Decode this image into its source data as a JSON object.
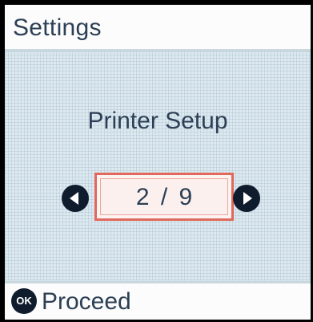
{
  "header": {
    "title": "Settings"
  },
  "menu": {
    "title": "Printer Setup",
    "page_indicator": "2 / 9",
    "current_page": 2,
    "total_pages": 9
  },
  "footer": {
    "ok_icon_label": "OK",
    "action_label": "Proceed"
  },
  "icons": {
    "prev": "chevron-left-icon",
    "next": "chevron-right-icon",
    "ok": "ok-button-icon"
  },
  "colors": {
    "text": "#2c3f55",
    "highlight_border": "#e0685c",
    "content_background": "#dde9f0",
    "icon_fill": "#0f1c2e"
  }
}
